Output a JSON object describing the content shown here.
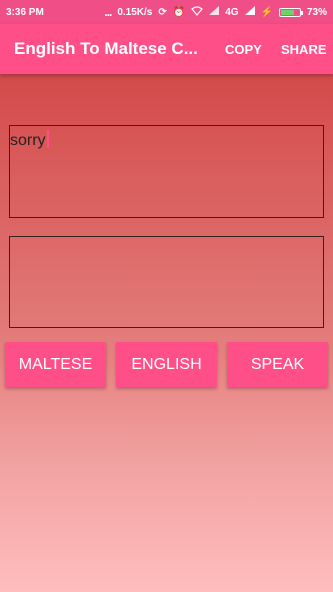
{
  "status": {
    "time": "3:36 PM",
    "dots": "...",
    "speed": "0.15K/s",
    "network": "4G",
    "battery": "73%",
    "battery_level": 0.73
  },
  "appbar": {
    "title": "English To Maltese C...",
    "copy_label": "COPY",
    "share_label": "SHARE"
  },
  "input": {
    "value": "sorry"
  },
  "output": {
    "value": ""
  },
  "buttons": {
    "maltese": "MALTESE",
    "english": "ENGLISH",
    "speak": "SPEAK"
  },
  "colors": {
    "accent": "#ff4f88",
    "statusbar": "#ef4f86",
    "battery_fill": "#6fd36a"
  },
  "icons": [
    "sync-icon",
    "alarm-icon",
    "wifi-icon",
    "signal-icon",
    "battery-icon"
  ]
}
